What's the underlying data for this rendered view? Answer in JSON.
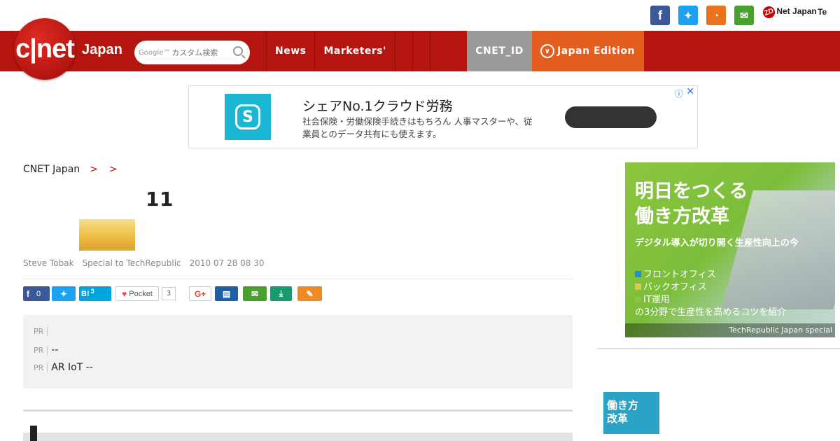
{
  "social": {
    "zdnet_label": "Net Japan",
    "zdnet_mark": "ZD",
    "techrepublic_label": "Te"
  },
  "header": {
    "logo_text": "c|net",
    "edition_label": "Japan",
    "search_placeholder": "カスタム検索",
    "search_brand": "Google™",
    "nav": [
      {
        "label": "News"
      },
      {
        "label": "Marketers'"
      }
    ],
    "cnet_id": "CNET_ID",
    "japan_edition": "Japan Edition"
  },
  "ad": {
    "title": "シェアNo.1クラウド労務",
    "desc": "社会保険・労働保険手続きはもちろん 人事マスターや、従業員とのデータ共有にも使えます。",
    "info_icon": "ⓘ",
    "close_icon": "✕"
  },
  "breadcrumb": {
    "items": [
      "CNET Japan",
      "",
      ""
    ],
    "separator": ">"
  },
  "article": {
    "title": "",
    "byline": "Steve Tobak　Special to TechRepublic　2010 07 28  08 30",
    "title_suffix": "11"
  },
  "share": {
    "facebook_count": "0",
    "hatena_count": "3",
    "pocket_label": "Pocket",
    "pocket_count": "3",
    "google_label": "G+",
    "hatena_label": "B!"
  },
  "pr": {
    "tag": "PR",
    "items": [
      {
        "text": ""
      },
      {
        "text": "--"
      },
      {
        "text": "AR IoT --"
      }
    ]
  },
  "side_ad": {
    "title_line1": "明日をつくる",
    "title_line2": "働き方改革",
    "subtitle": "デジタル導入が切り開く生産性向上の今",
    "list": [
      "フロントオフィス",
      "バックオフィス",
      "IT運用"
    ],
    "list_colors": [
      "#1f8fd1",
      "#e6c34a",
      "#8cc63f"
    ],
    "tagline": "の3分野で生産性を高めるコツを紹介",
    "footer": "TechRepublic Japan special"
  },
  "sidebar": {
    "heading": "",
    "item_thumb_line1": "働き方",
    "item_thumb_line2": "改革"
  },
  "colors": {
    "brand_red": "#b5150f",
    "edition_orange": "#e25d1e",
    "cnetid_grey": "#9a9a9a"
  }
}
